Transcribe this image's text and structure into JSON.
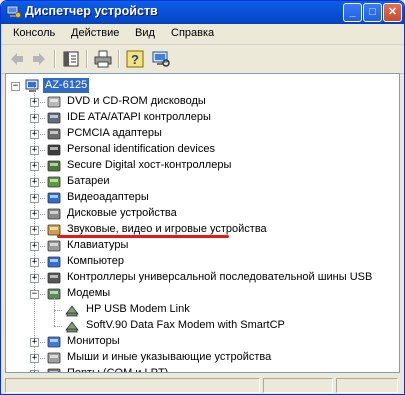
{
  "window": {
    "title": "Диспетчер устройств"
  },
  "title_buttons": [
    "_",
    "□",
    "✕"
  ],
  "menu": [
    "Консоль",
    "Действие",
    "Вид",
    "Справка"
  ],
  "toolbar": [
    "back-icon",
    "forward-icon",
    "properties-pane-icon",
    "print-icon",
    "help-icon",
    "scan-hardware-icon"
  ],
  "tree": {
    "root": "AZ-6125",
    "categories": [
      {
        "label": "DVD и CD-ROM дисководы",
        "icon": "cdrom-icon",
        "expanded": false
      },
      {
        "label": "IDE ATA/ATAPI контроллеры",
        "icon": "ide-controller-icon",
        "expanded": false
      },
      {
        "label": "PCMCIA адаптеры",
        "icon": "pcmcia-icon",
        "expanded": false
      },
      {
        "label": "Personal identification devices",
        "icon": "pid-device-icon",
        "expanded": false
      },
      {
        "label": "Secure Digital хост-контроллеры",
        "icon": "sd-controller-icon",
        "expanded": false
      },
      {
        "label": "Батареи",
        "icon": "battery-icon",
        "expanded": false
      },
      {
        "label": "Видеоадаптеры",
        "icon": "display-adapter-icon",
        "expanded": false
      },
      {
        "label": "Дисковые устройства",
        "icon": "disk-drive-icon",
        "expanded": false
      },
      {
        "label": "Звуковые, видео и игровые устройства",
        "icon": "sound-icon",
        "expanded": false
      },
      {
        "label": "Клавиатуры",
        "icon": "keyboard-icon",
        "expanded": false
      },
      {
        "label": "Компьютер",
        "icon": "computer-icon",
        "expanded": false
      },
      {
        "label": "Контроллеры универсальной последовательной шины USB",
        "icon": "usb-icon",
        "expanded": false
      },
      {
        "label": "Модемы",
        "icon": "modem-icon",
        "expanded": true,
        "children": [
          "HP USB Modem Link",
          "SoftV.90 Data Fax Modem with SmartCP"
        ]
      },
      {
        "label": "Мониторы",
        "icon": "monitor-icon",
        "expanded": false
      },
      {
        "label": "Мыши и иные указывающие устройства",
        "icon": "mouse-icon",
        "expanded": false
      },
      {
        "label": "Порты (COM и LPT)",
        "icon": "port-icon",
        "expanded": false
      }
    ]
  },
  "annotation": {
    "highlighted_item": "HP USB Modem Link",
    "color": "#e21a1a"
  }
}
